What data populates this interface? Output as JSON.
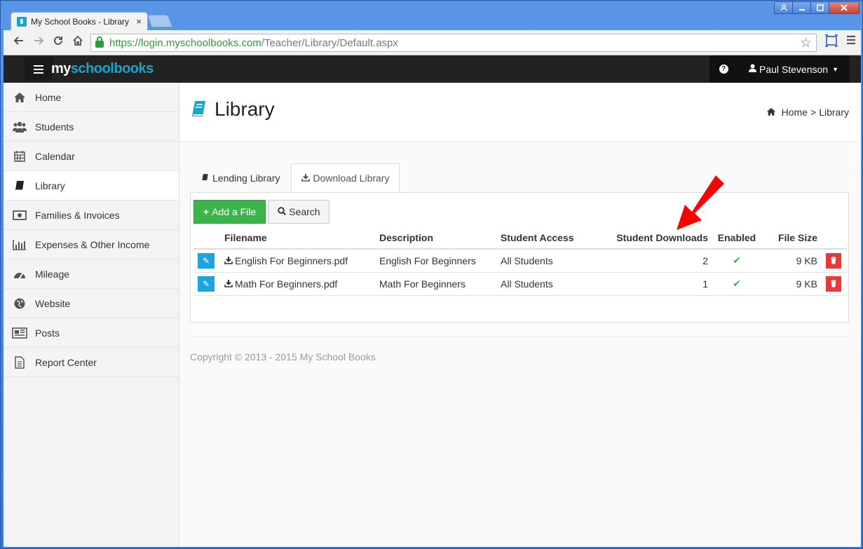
{
  "browser": {
    "tab_title": "My School Books - Library",
    "tab_close": "×",
    "url_secure": "https://",
    "url_host": "login.myschoolbooks.com",
    "url_path": "/Teacher/Library/Default.aspx",
    "nav_icons": [
      "back-icon",
      "forward-icon",
      "reload-icon",
      "home-icon"
    ],
    "window_controls": [
      "user-icon",
      "minimize-icon",
      "maximize-icon",
      "close-icon"
    ]
  },
  "app": {
    "brand_part1": "my",
    "brand_part2": "schoolbooks",
    "help_label": "?",
    "user_name": "Paul Stevenson"
  },
  "sidebar": {
    "items": [
      {
        "label": "Home",
        "icon": "home-icon"
      },
      {
        "label": "Students",
        "icon": "users-icon"
      },
      {
        "label": "Calendar",
        "icon": "calendar-icon"
      },
      {
        "label": "Library",
        "icon": "book-icon",
        "active": true
      },
      {
        "label": "Families & Invoices",
        "icon": "money-icon"
      },
      {
        "label": "Expenses & Other Income",
        "icon": "bar-chart-icon"
      },
      {
        "label": "Mileage",
        "icon": "dashboard-icon"
      },
      {
        "label": "Website",
        "icon": "globe-icon"
      },
      {
        "label": "Posts",
        "icon": "newspaper-icon"
      },
      {
        "label": "Report Center",
        "icon": "file-text-icon"
      }
    ]
  },
  "page": {
    "title": "Library",
    "breadcrumb_home": "Home",
    "breadcrumb_sep": ">",
    "breadcrumb_current": "Library",
    "accent": "#1aa5c8"
  },
  "tabs": [
    {
      "label": "Lending Library",
      "icon": "book-icon"
    },
    {
      "label": "Download Library",
      "icon": "download-icon",
      "active": true
    }
  ],
  "actions": {
    "add_file": "Add a File",
    "search": "Search"
  },
  "table": {
    "headers": {
      "filename": "Filename",
      "description": "Description",
      "access": "Student Access",
      "downloads": "Student Downloads",
      "enabled": "Enabled",
      "size": "File Size"
    },
    "rows": [
      {
        "filename": "English For Beginners.pdf",
        "description": "English For Beginners",
        "access": "All Students",
        "downloads": "2",
        "enabled": "✔",
        "size": "9 KB"
      },
      {
        "filename": "Math For Beginners.pdf",
        "description": "Math For Beginners",
        "access": "All Students",
        "downloads": "1",
        "enabled": "✔",
        "size": "9 KB"
      }
    ]
  },
  "footer": {
    "copyright": "Copyright © 2013 - 2015 My School Books"
  },
  "colors": {
    "success": "#3bb54a",
    "info": "#1aa5e0",
    "danger": "#e43a3a",
    "annotation_arrow": "#ff0000"
  }
}
